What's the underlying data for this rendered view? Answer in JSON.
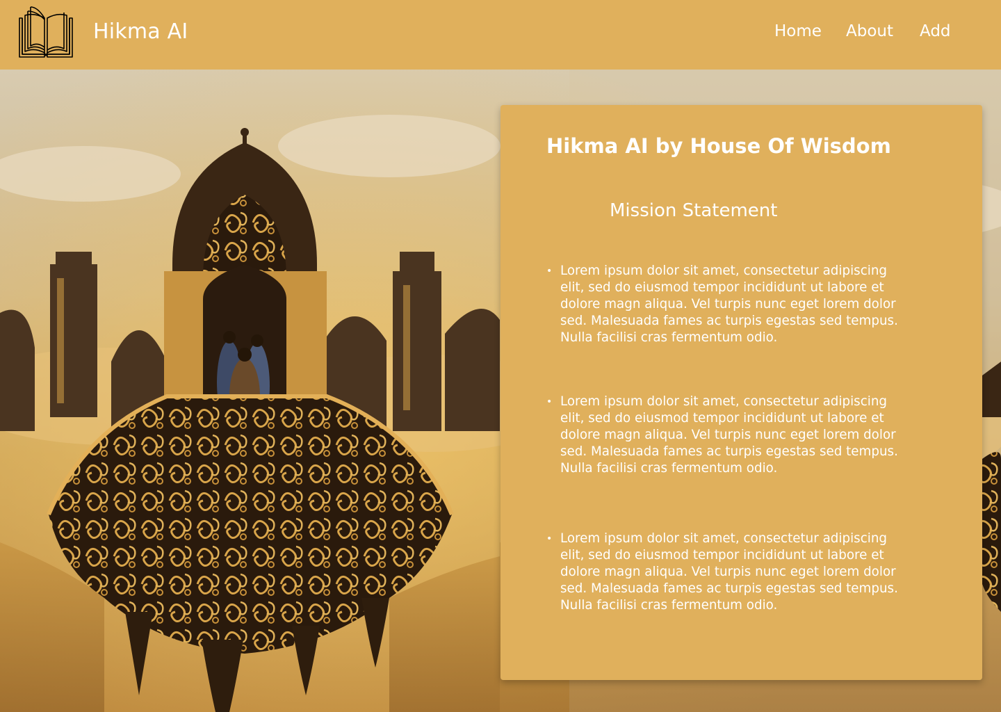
{
  "header": {
    "logo_icon": "open-book-icon",
    "brand": "Hikma AI",
    "nav": [
      {
        "label": "Home"
      },
      {
        "label": "About"
      },
      {
        "label": "Add"
      }
    ],
    "background": "#e0b05c"
  },
  "hero": {
    "image": "painting of ornate domed palace with gold arabesque and clouds"
  },
  "card": {
    "title": "Hikma AI by House Of Wisdom",
    "subtitle": "Mission Statement",
    "items": [
      "Lorem ipsum dolor sit amet, consectetur adipiscing elit, sed do eiusmod tempor incididunt ut labore et dolore magn aliqua. Vel turpis nunc eget lorem dolor sed. Malesuada fames ac turpis egestas sed tempus. Nulla facilisi cras fermentum odio.",
      "Lorem ipsum dolor sit amet, consectetur adipiscing elit, sed do eiusmod tempor incididunt ut labore et dolore magn aliqua. Vel turpis nunc eget lorem dolor sed. Malesuada fames ac turpis egestas sed tempus. Nulla facilisi cras fermentum odio.",
      "Lorem ipsum dolor sit amet, consectetur adipiscing elit, sed do eiusmod tempor incididunt ut labore et dolore magn aliqua. Vel turpis nunc eget lorem dolor sed. Malesuada fames ac turpis egestas sed tempus. Nulla facilisi cras fermentum odio."
    ],
    "background": "#e0b05c"
  }
}
